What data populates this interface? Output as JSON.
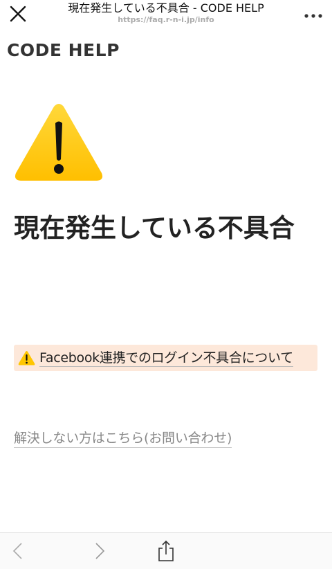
{
  "browser": {
    "page_title": "現在発生している不具合 - CODE HELP",
    "url": "https://faq.r-n-i.jp/info",
    "close_icon": "close-icon",
    "more_icon": "more-options-icon"
  },
  "site": {
    "name": "CODE HELP"
  },
  "main": {
    "warning_icon": "warning-icon",
    "heading": "現在発生している不具合",
    "notice": {
      "icon": "warning-icon",
      "label": "Facebook連携でのログイン不具合について"
    },
    "contact_link": "解決しない方はこちら(お問い合わせ)"
  },
  "toolbar": {
    "back_icon": "chevron-left-icon",
    "forward_icon": "chevron-right-icon",
    "share_icon": "share-icon"
  },
  "colors": {
    "notice_bg": "#fde8da",
    "warning_yellow": "#ffc600"
  }
}
